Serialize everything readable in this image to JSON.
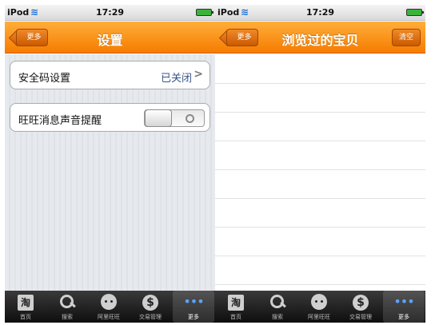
{
  "status_bar": {
    "carrier": "iPod",
    "time": "17:29"
  },
  "left_screen": {
    "back_label": "更多",
    "title": "设置",
    "rows": [
      {
        "label": "安全码设置",
        "value": "已关闭"
      },
      {
        "label": "旺旺消息声音提醒",
        "toggle": "off"
      }
    ]
  },
  "right_screen": {
    "back_label": "更多",
    "title": "浏览过的宝贝",
    "action_label": "清空"
  },
  "tab_bar": {
    "tabs": [
      {
        "label": "首页",
        "icon": "taobao-icon"
      },
      {
        "label": "搜索",
        "icon": "search-icon"
      },
      {
        "label": "阿里旺旺",
        "icon": "wangwang-icon"
      },
      {
        "label": "交易管理",
        "icon": "dollar-icon"
      },
      {
        "label": "更多",
        "icon": "more-icon",
        "active": true
      }
    ],
    "icon_glyphs": {
      "taobao": "淘",
      "dollar": "$",
      "more": "•••"
    }
  },
  "colors": {
    "navbar": "#f57c00",
    "active_icon": "#5aa3ff",
    "value_text": "#385487"
  }
}
